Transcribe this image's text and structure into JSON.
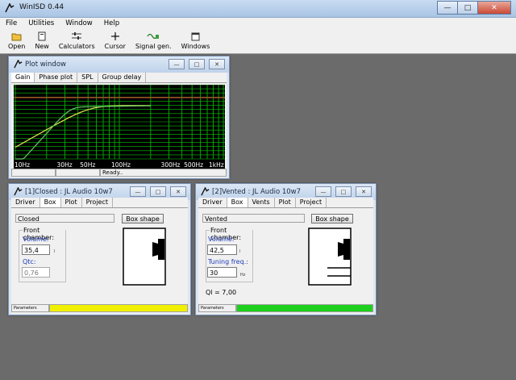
{
  "app": {
    "title": "WinISD 0.44"
  },
  "menu": [
    "File",
    "Utilities",
    "Window",
    "Help"
  ],
  "toolbar": [
    {
      "label": "Open",
      "icon": "folder-open-icon"
    },
    {
      "label": "New",
      "icon": "new-document-icon"
    },
    {
      "label": "Calculators",
      "icon": "calculator-sliders-icon"
    },
    {
      "label": "Cursor",
      "icon": "cursor-crosshair-icon"
    },
    {
      "label": "Signal gen.",
      "icon": "signal-generator-icon"
    },
    {
      "label": "Windows",
      "icon": "windows-icon"
    }
  ],
  "plot": {
    "title": "Plot window",
    "tabs": [
      "Gain",
      "Phase plot",
      "SPL",
      "Group delay"
    ],
    "x_ticks": [
      "10Hz",
      "30Hz",
      "50Hz",
      "100Hz",
      "300Hz",
      "500Hz",
      "1kHz"
    ],
    "status": "Ready..",
    "colors": {
      "background": "#000000",
      "grid": "#00c800",
      "curve_closed": "#e6e650",
      "curve_vented": "#64c864",
      "reference": "#c83232"
    }
  },
  "closed": {
    "title": "[1]Closed : JL Audio 10w7",
    "tabs": [
      "Driver",
      "Box",
      "Plot",
      "Project"
    ],
    "type_value": "Closed",
    "box_shape_label": "Box shape",
    "group_title": "Front chamber:",
    "volume_label": "Volume:",
    "volume_value": "35,4",
    "volume_unit": "l",
    "qtc_label": "Qtc:",
    "qtc_value": "0,76",
    "status_label": "Parameters",
    "status_color": "#f0f000"
  },
  "vented": {
    "title": "[2]Vented : JL Audio 10w7",
    "tabs": [
      "Driver",
      "Box",
      "Vents",
      "Plot",
      "Project"
    ],
    "type_value": "Vented",
    "box_shape_label": "Box shape",
    "group_title": "Front chamber:",
    "volume_label": "Volume:",
    "volume_value": "42,5",
    "volume_unit": "l",
    "tuning_label": "Tuning freq.:",
    "tuning_value": "30",
    "tuning_unit": "Hz",
    "ql_text": "Ql = 7,00",
    "status_label": "Parameters",
    "status_color": "#1ed01e"
  }
}
